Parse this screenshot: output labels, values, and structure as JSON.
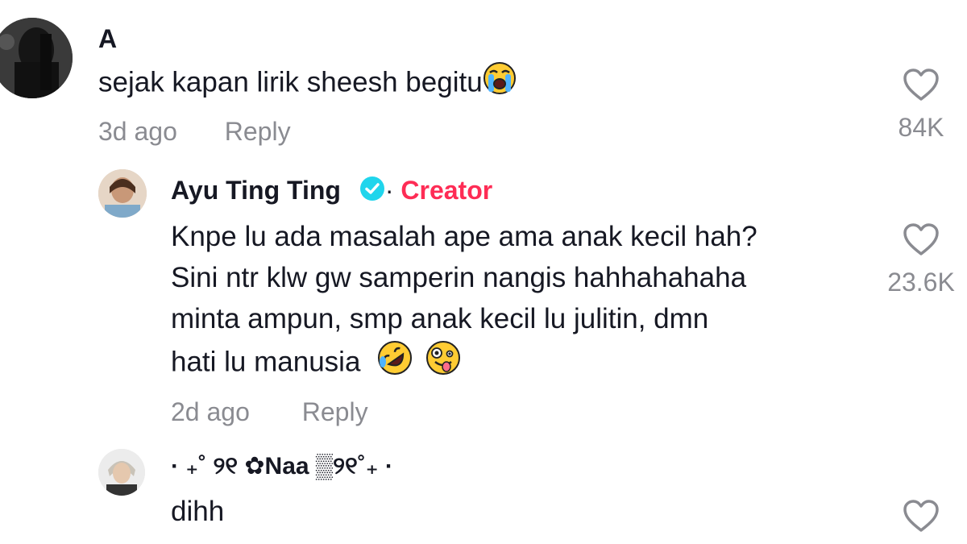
{
  "comments": [
    {
      "author": "A",
      "text_lines": [
        "sejak kapan lirik sheesh begitu"
      ],
      "emoji": "loudly-crying-face",
      "time": "3d ago",
      "reply_label": "Reply",
      "likes": "84K"
    },
    {
      "author": "Ayu Ting Ting",
      "verified": true,
      "separator": "·",
      "badge": "Creator",
      "text_lines": [
        "Knpe lu ada masalah ape ama anak kecil hah?",
        "Sini ntr klw gw samperin nangis hahhahahaha",
        "minta ampun, smp anak kecil lu julitin, dmn",
        "hati lu manusia"
      ],
      "emojis": [
        "rolling-on-floor-laughing",
        "zany-face"
      ],
      "time": "2d ago",
      "reply_label": "Reply",
      "likes": "23.6K"
    },
    {
      "author": "· ₊˚ ୨୧ ✿Naa ▒୨୧˚₊ ·",
      "text_lines": [
        "dihh"
      ],
      "likes": ""
    }
  ],
  "colors": {
    "text": "#161823",
    "muted": "#8a8b91",
    "creator": "#fe2c55",
    "verified": "#20d5ec"
  }
}
